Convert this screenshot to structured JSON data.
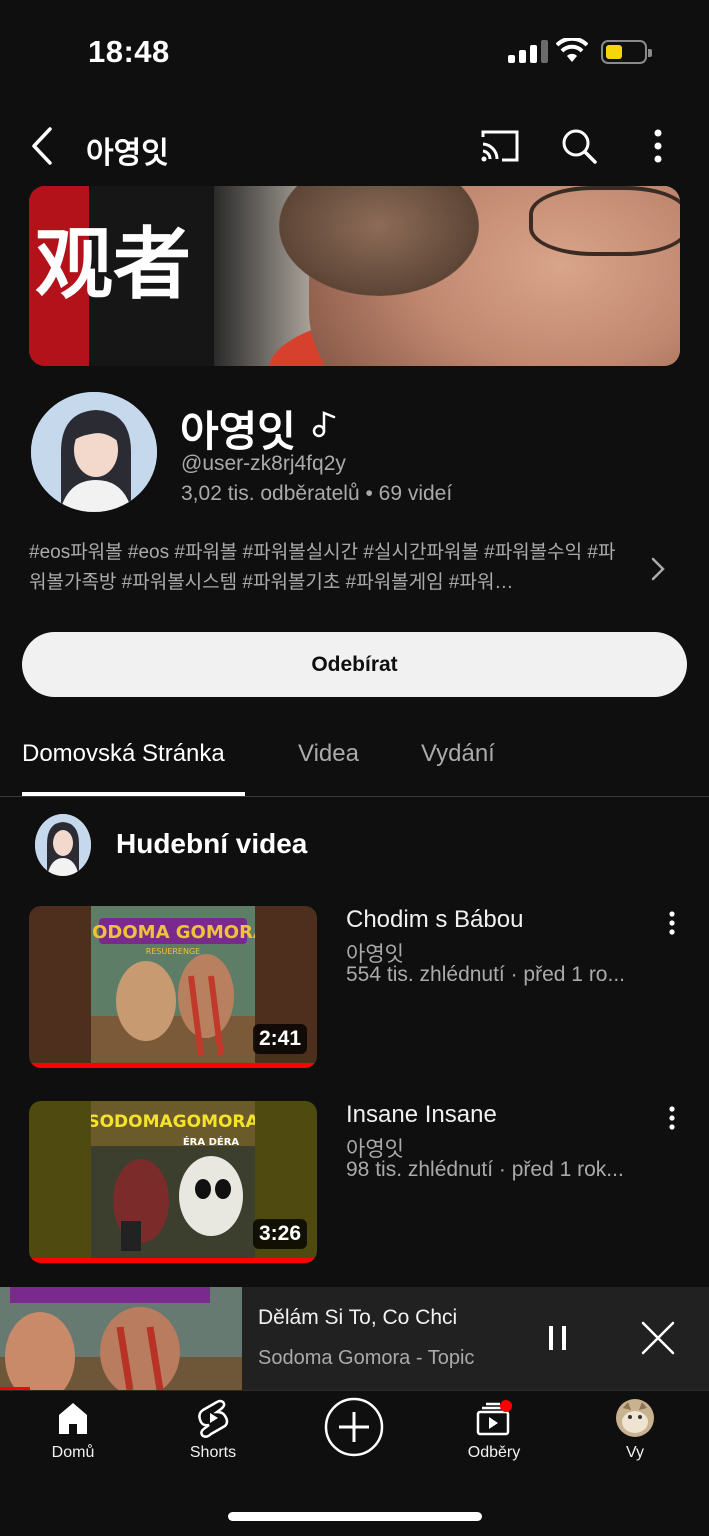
{
  "status_bar": {
    "time": "18:48"
  },
  "header": {
    "title": "아영잇"
  },
  "banner": {
    "overlay_text": "观者"
  },
  "channel": {
    "name": "아영잇",
    "handle": "@user-zk8rj4fq2y",
    "stats": "3,02 tis. odběratelů • 69 videí",
    "description": "#eos파워볼 #eos #파워볼 #파워볼실시간 #실시간파워볼 #파워볼수익 #파워볼가족방 #파워볼시스템 #파워볼기초 #파워볼게임 #파워…",
    "subscribe_label": "Odebírat"
  },
  "tabs": [
    {
      "label": "Domovská Stránka",
      "active": true
    },
    {
      "label": "Videa",
      "active": false
    },
    {
      "label": "Vydání",
      "active": false
    }
  ],
  "section": {
    "title": "Hudební videa"
  },
  "videos": [
    {
      "title": "Chodim s Bábou",
      "channel": "아영잇",
      "meta": "554 tis. zhlédnutí · před 1 ro...",
      "duration": "2:41",
      "art_text": "SODOMA GOMORA",
      "art_sub": "RESUERENGE"
    },
    {
      "title": "Insane Insane",
      "channel": "아영잇",
      "meta": "98 tis. zhlédnutí · před 1 rok...",
      "duration": "3:26",
      "art_text": "SODOMAGOMORA",
      "art_sub": "ÉRA DÉRA"
    }
  ],
  "mini_player": {
    "title": "Dělám Si To, Co Chci",
    "subtitle": "Sodoma Gomora - Topic"
  },
  "nav": [
    {
      "label": "Domů",
      "icon": "home-icon"
    },
    {
      "label": "Shorts",
      "icon": "shorts-icon"
    },
    {
      "label": "",
      "icon": "create-icon"
    },
    {
      "label": "Odběry",
      "icon": "subscriptions-icon"
    },
    {
      "label": "Vy",
      "icon": "profile-avatar"
    }
  ],
  "colors": {
    "background": "#0f0f0f",
    "accent": "#ff0000",
    "button_bg": "#f1f1f1",
    "secondary_text": "#aaaaaa"
  }
}
